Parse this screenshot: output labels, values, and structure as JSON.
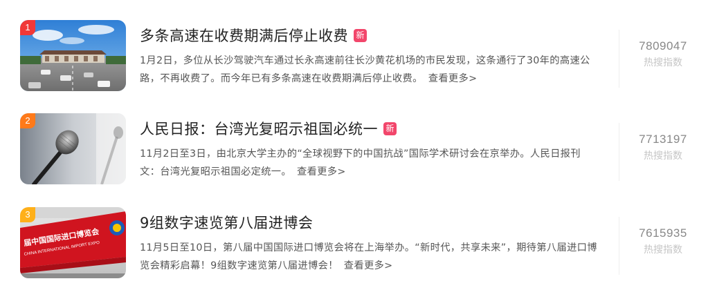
{
  "hot_list": [
    {
      "rank": "1",
      "rank_color": "#f13838",
      "title": "多条高速在收费期满后停止收费",
      "badge": "新",
      "description": "1月2日，多位从长沙驾驶汽车通过长永高速前往长沙黄花机场的市民发现，这条通行了30年的高速公路，不再收费了。而今年已有多条高速在收费期满后停止收费。",
      "more_label": "查看更多>",
      "count": "7809047",
      "count_label": "热搜指数",
      "image": "highway-toll-station-photo"
    },
    {
      "rank": "2",
      "rank_color": "#ff7a1a",
      "title": "人民日报：台湾光复昭示祖国必统一",
      "badge": "新",
      "description": "11月2日至3日，由北京大学主办的“全球视野下的中国抗战”国际学术研讨会在京举办。人民日报刊文：台湾光复昭示祖国必定统一。",
      "more_label": "查看更多>",
      "count": "7713197",
      "count_label": "热搜指数",
      "image": "microphones-photo"
    },
    {
      "rank": "3",
      "rank_color": "#ffb01a",
      "title": "9组数字速览第八届进博会",
      "badge": "",
      "description": "11月5日至10日，第八届中国国际进口博览会将在上海举办。“新时代，共享未来”，期待第八届进口博览会精彩启幕！9组数字速览第八届进博会！",
      "more_label": "查看更多>",
      "count": "7615935",
      "count_label": "热搜指数",
      "image": "import-expo-banner-photo",
      "image_text_cn": "届中国国际进口博览会",
      "image_text_en": "CHINA INTERNATIONAL IMPORT EXPO"
    }
  ]
}
